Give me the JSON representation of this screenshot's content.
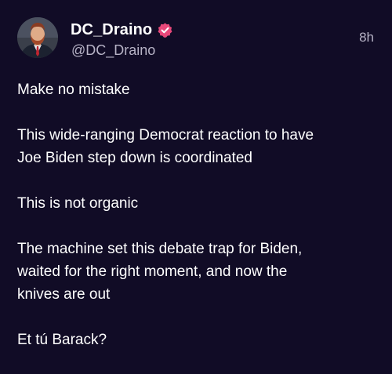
{
  "post": {
    "author": {
      "display_name": "DC_Draino",
      "handle": "@DC_Draino",
      "verified": true,
      "avatar_icon": "profile-photo"
    },
    "timestamp": "8h",
    "paragraphs": [
      "Make no mistake",
      "This wide-ranging Democrat reaction to have\nJoe Biden step down is coordinated",
      "This is not organic",
      "The machine set this debate trap for Biden,\nwaited for the right moment, and now the\nknives are out",
      "Et tú Barack?"
    ]
  },
  "colors": {
    "background": "#110c26",
    "text": "#ffffff",
    "secondary_text": "#b7b3c6",
    "verified_badge": "#e8487a"
  }
}
